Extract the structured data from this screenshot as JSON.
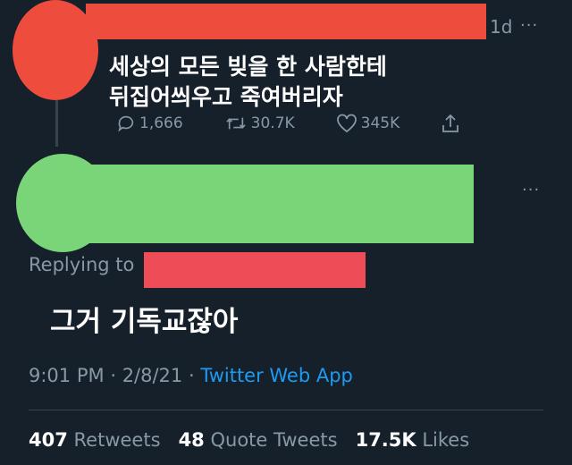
{
  "original_tweet": {
    "time": "1d",
    "more": "···",
    "text_line1": "세상의 모든 빚을 한 사람한테",
    "text_line2": "뒤집어씌우고 죽여버리자",
    "replies": "1,666",
    "retweets": "30.7K",
    "likes": "345K",
    "icons": [
      "reply-icon",
      "retweet-icon",
      "like-icon",
      "share-icon"
    ]
  },
  "reply_tweet": {
    "more": "···",
    "replying_to_label": "Replying to",
    "text": "그거 기독교잖아",
    "time": "9:01 PM",
    "date": "2/8/21",
    "separator": "·",
    "app": "Twitter Web App"
  },
  "stats": {
    "retweets_count": "407",
    "retweets_label": "Retweets",
    "quote_count": "48",
    "quote_label": "Quote Tweets",
    "likes_count": "17.5K",
    "likes_label": "Likes"
  },
  "colors": {
    "background": "#15202b",
    "redaction_red": "#ee4d3d",
    "redaction_green": "#79d578",
    "link_blue": "#1d9bf0"
  }
}
